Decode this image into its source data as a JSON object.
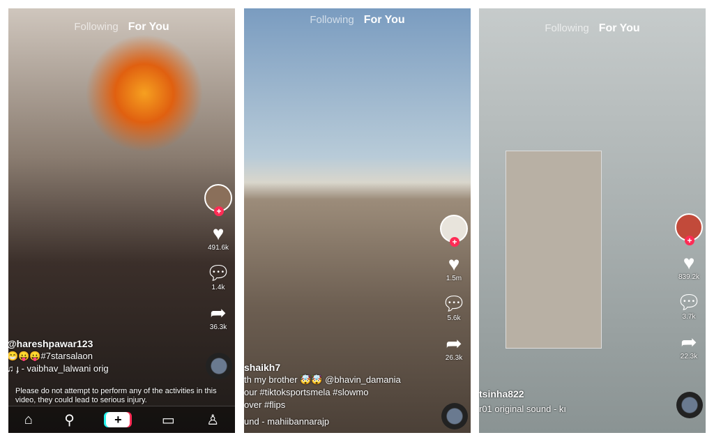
{
  "tabs": {
    "following": "Following",
    "for_you": "For You"
  },
  "panels": [
    {
      "likes": "491.6k",
      "comments": "1.4k",
      "shares": "36.3k",
      "user": "@hareshpawar123",
      "caption": "😁😛😛#7starsalaon",
      "sound": "♫ ɟ - vaibhav_lalwani   orig",
      "warning": "Please do not attempt to perform any of the activities in this video, they could lead to serious injury."
    },
    {
      "likes": "1.5m",
      "comments": "5.6k",
      "shares": "26.3k",
      "user": "shaikh7",
      "caption_lines": [
        "th my brother 🤯🤯 @bhavin_damania",
        "our #tiktoksportsmela #slowmo",
        "over #flips"
      ],
      "sound": "und - mahiibannarajp"
    },
    {
      "likes": "839.2k",
      "comments": "3.7k",
      "shares": "22.3k",
      "user": "tsinha822",
      "sound": "r01   original sound - kı"
    }
  ],
  "nav": {
    "home": "⌂",
    "discover": "⚲",
    "create": "+",
    "inbox": "▭",
    "profile": "♙"
  },
  "colors": {
    "accent": "#fe2c55",
    "cyan": "#25f4ee"
  }
}
